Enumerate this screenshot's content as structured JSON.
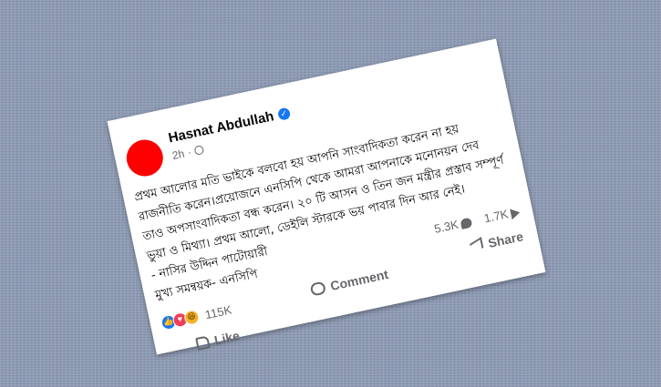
{
  "post": {
    "author": "Hasnat Abdullah",
    "time": "2h",
    "verified_symbol": "✓",
    "text_lines": [
      "প্রথম আলোর মতি ভাইকে বলবো হয় আপনি সাংবাদিকতা করেন না হয়",
      "রাজনীতি করেন।প্রয়োজনে এনসিপি থেকে আমরা আপনাকে মনোনয়ন দেব",
      "তাও অপসাংবাদিকতা বন্ধ করেন। ২০ টি আসন ও তিন জন মন্ত্রীর প্রস্তাব সম্পূর্ণ",
      "ভুয়া ও মিথ্যা। প্রথম আলো, ডেইলি স্টারকে ভয় পাবার দিন আর নেই।",
      "- নাসির উদ্দিন পাটোয়ারী",
      "মুখ্য সমন্বয়ক- এনসিপি"
    ],
    "comments_count": "5.3K",
    "shares_count": "1.7K",
    "reactions_count": "115K",
    "reaction_icons": [
      "like-icon",
      "love-icon",
      "haha-icon"
    ],
    "like_symbol": "👍",
    "love_symbol": "♥",
    "haha_symbol": "😆"
  },
  "actions": {
    "like_label": "Like",
    "comment_label": "Comment",
    "share_label": "Share"
  },
  "colors": {
    "background": "#8f9cb5",
    "avatar": "#ff0000",
    "verified": "#1877f2",
    "secondary_text": "#65676b"
  }
}
